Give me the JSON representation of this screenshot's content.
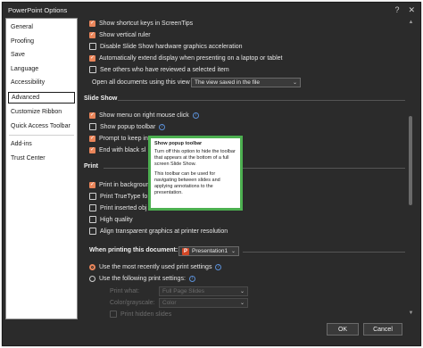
{
  "window": {
    "title": "PowerPoint Options",
    "help_glyph": "?",
    "close_glyph": "✕"
  },
  "sidebar": {
    "items": [
      {
        "label": "General"
      },
      {
        "label": "Proofing"
      },
      {
        "label": "Save"
      },
      {
        "label": "Language"
      },
      {
        "label": "Accessibility"
      },
      {
        "label": "Advanced"
      },
      {
        "label": "Customize Ribbon"
      },
      {
        "label": "Quick Access Toolbar"
      },
      {
        "label": "Add-ins"
      },
      {
        "label": "Trust Center"
      }
    ]
  },
  "display": {
    "show_shortcut_keys": "Show shortcut keys in ScreenTips",
    "show_vertical_ruler": "Show vertical ruler",
    "disable_hw_accel": "Disable Slide Show hardware graphics acceleration",
    "auto_extend": "Automatically extend display when presenting on a laptop or tablet",
    "see_others": "See others who have reviewed a selected item",
    "open_all_label": "Open all documents using this view",
    "open_all_value": "The view saved in the file"
  },
  "slideshow": {
    "heading": "Slide Show",
    "show_menu": "Show menu on right mouse click",
    "show_popup": "Show popup toolbar",
    "prompt_keep": "Prompt to keep in",
    "end_black": "End with black sl"
  },
  "print": {
    "heading": "Print",
    "background": "Print in backgroun",
    "truetype": "Print TrueType fo",
    "inserted": "Print inserted obj",
    "high_quality": "High quality",
    "align_transparent": "Align transparent graphics at printer resolution"
  },
  "when_printing": {
    "label": "When printing this document:",
    "doc_value": "Presentation1",
    "pres_icon": "P",
    "use_recent": "Use the most recently used print settings",
    "use_following": "Use the following print settings:",
    "print_what_label": "Print what:",
    "print_what_value": "Full Page Slides",
    "color_label": "Color/grayscale:",
    "color_value": "Color",
    "hidden_slides": "Print hidden slides"
  },
  "tooltip": {
    "title": "Show popup toolbar",
    "p1": "Turn off this option to hide the toolbar that appears at the bottom of a full screen Slide Show.",
    "p2": "This toolbar can be used for navigating between slides and applying annotations to the presentation."
  },
  "footer": {
    "ok": "OK",
    "cancel": "Cancel"
  },
  "colors": {
    "accent": "#e9855a",
    "tooltip_border": "#4caf50",
    "bg": "#2b2b2b"
  }
}
